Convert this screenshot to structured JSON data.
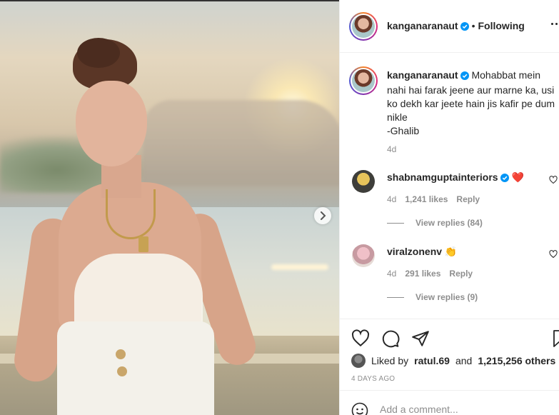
{
  "post": {
    "username": "kanganaranaut",
    "follow_status": "Following",
    "caption": "Mohabbat mein nahi hai farak jeene aur marne ka, usi ko dekh kar jeete hain jis kafir pe dum nikle\n-Ghalib",
    "caption_time": "4d"
  },
  "comments": [
    {
      "username": "shabnamguptainteriors",
      "emoji": "❤️",
      "time": "4d",
      "likes": "1,241 likes",
      "reply_label": "Reply",
      "view_replies": "View replies (84)"
    },
    {
      "username": "viralzonenv",
      "emoji": "👏",
      "time": "4d",
      "likes": "291 likes",
      "reply_label": "Reply",
      "view_replies": "View replies (9)"
    }
  ],
  "likes": {
    "prefix": "Liked by",
    "user": "ratul.69",
    "and": "and",
    "others": "1,215,256 others"
  },
  "posted_time": "4 DAYS AGO",
  "add_comment": {
    "placeholder": "Add a comment..."
  },
  "colors": {
    "verified": "#0095f6",
    "heart": "#ed4956"
  },
  "icons": [
    "verified-icon",
    "more-options-icon",
    "heart-icon",
    "comment-icon",
    "share-icon",
    "save-icon",
    "emoji-icon",
    "chevron-right-icon"
  ]
}
